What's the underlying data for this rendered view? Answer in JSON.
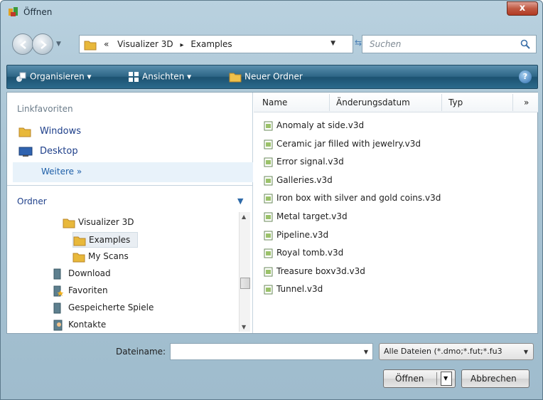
{
  "window": {
    "title": "Öffnen",
    "close": "x"
  },
  "address": {
    "path_prefix": "«",
    "path_parts": [
      "Visualizer 3D",
      "▸",
      "Examples"
    ],
    "search_placeholder": "Suchen"
  },
  "toolbar": {
    "organize": "Organisieren ▾",
    "views": "Ansichten ▾",
    "new_folder": "Neuer Ordner",
    "help": "?"
  },
  "left_pane": {
    "favorites_title": "Linkfavoriten",
    "favorites": [
      {
        "label": "Windows",
        "icon": "folder-icon"
      },
      {
        "label": "Desktop",
        "icon": "desktop-icon"
      }
    ],
    "more": "Weitere  »",
    "folders_title": "Ordner",
    "tree": [
      {
        "label": "Visualizer 3D",
        "icon": "folder-icon"
      },
      {
        "label": "Examples",
        "icon": "folder-icon",
        "selected": true
      },
      {
        "label": "My Scans",
        "icon": "folder-icon"
      },
      {
        "label": "Download",
        "icon": "library-icon"
      },
      {
        "label": "Favoriten",
        "icon": "favorites-folder-icon"
      },
      {
        "label": "Gespeicherte Spiele",
        "icon": "library-icon"
      },
      {
        "label": "Kontakte",
        "icon": "contacts-icon"
      }
    ]
  },
  "right_pane": {
    "columns": [
      "Name",
      "Änderungsdatum",
      "Typ",
      "»"
    ],
    "files": [
      "Anomaly at side.v3d",
      "Ceramic jar filled with jewelry.v3d",
      "Error signal.v3d",
      "Galleries.v3d",
      "Iron box with silver and gold coins.v3d",
      "Metal target.v3d",
      "Pipeline.v3d",
      "Royal tomb.v3d",
      "Treasure boxv3d.v3d",
      "Tunnel.v3d"
    ]
  },
  "bottom": {
    "filename_label": "Dateiname:",
    "filename_value": "",
    "filter": "Alle Dateien (*.dmo;*.fut;*.fu3",
    "open": "Öffnen",
    "cancel": "Abbrechen"
  }
}
